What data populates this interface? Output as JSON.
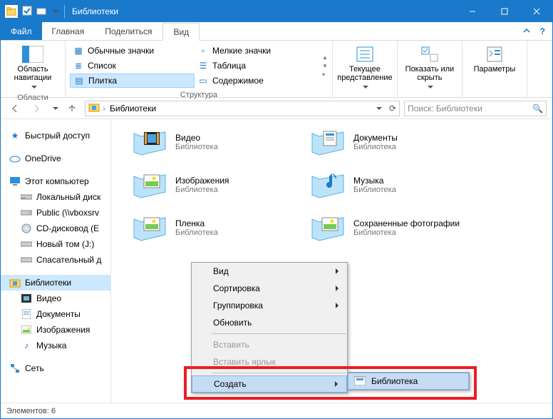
{
  "titlebar": {
    "title": "Библиотеки"
  },
  "windowcontrols": {
    "min": "min",
    "max": "max",
    "close": "close"
  },
  "tabs": {
    "file": "Файл",
    "items": [
      "Главная",
      "Поделиться",
      "Вид"
    ],
    "active_index": 2
  },
  "ribbon": {
    "groups": {
      "regions": {
        "label": "Области",
        "nav_area": "Область навигации"
      },
      "structure": {
        "label": "Структура",
        "items": [
          {
            "label": "Обычные значки"
          },
          {
            "label": "Мелкие значки"
          },
          {
            "label": "Список"
          },
          {
            "label": "Таблица"
          },
          {
            "label": "Плитка",
            "selected": true
          },
          {
            "label": "Содержимое"
          }
        ]
      },
      "current_view": {
        "label": "Текущее представление"
      },
      "show_hide": {
        "label": "Показать или скрыть"
      },
      "params": {
        "label": "Параметры"
      }
    }
  },
  "address": {
    "crumbs": [
      "Библиотеки"
    ],
    "search_placeholder": "Поиск: Библиотеки"
  },
  "sidebar": {
    "quick": "Быстрый доступ",
    "onedrive": "OneDrive",
    "thispc": "Этот компьютер",
    "drives": [
      "Локальный диск",
      "Public (\\\\vboxsrv",
      "CD-дисковод (E",
      "Новый том (J:)",
      "Спасательный д"
    ],
    "libraries": "Библиотеки",
    "lib_children": [
      "Видео",
      "Документы",
      "Изображения",
      "Музыка"
    ],
    "network": "Сеть"
  },
  "libraries": [
    {
      "name": "Видео",
      "sub": "Библиотека",
      "kind": "video"
    },
    {
      "name": "Документы",
      "sub": "Библиотека",
      "kind": "documents"
    },
    {
      "name": "Изображения",
      "sub": "Библиотека",
      "kind": "images"
    },
    {
      "name": "Музыка",
      "sub": "Библиотека",
      "kind": "music"
    },
    {
      "name": "Пленка",
      "sub": "Библиотека",
      "kind": "images"
    },
    {
      "name": "Сохраненные фотографии",
      "sub": "Библиотека",
      "kind": "images"
    }
  ],
  "context_menu": {
    "view": "Вид",
    "sort": "Сортировка",
    "group": "Группировка",
    "refresh": "Обновить",
    "paste": "Вставить",
    "paste_shortcut": "Вставить ярлык",
    "new": "Создать",
    "submenu": {
      "library": "Библиотека"
    }
  },
  "statusbar": {
    "elements": "Элементов: 6"
  }
}
